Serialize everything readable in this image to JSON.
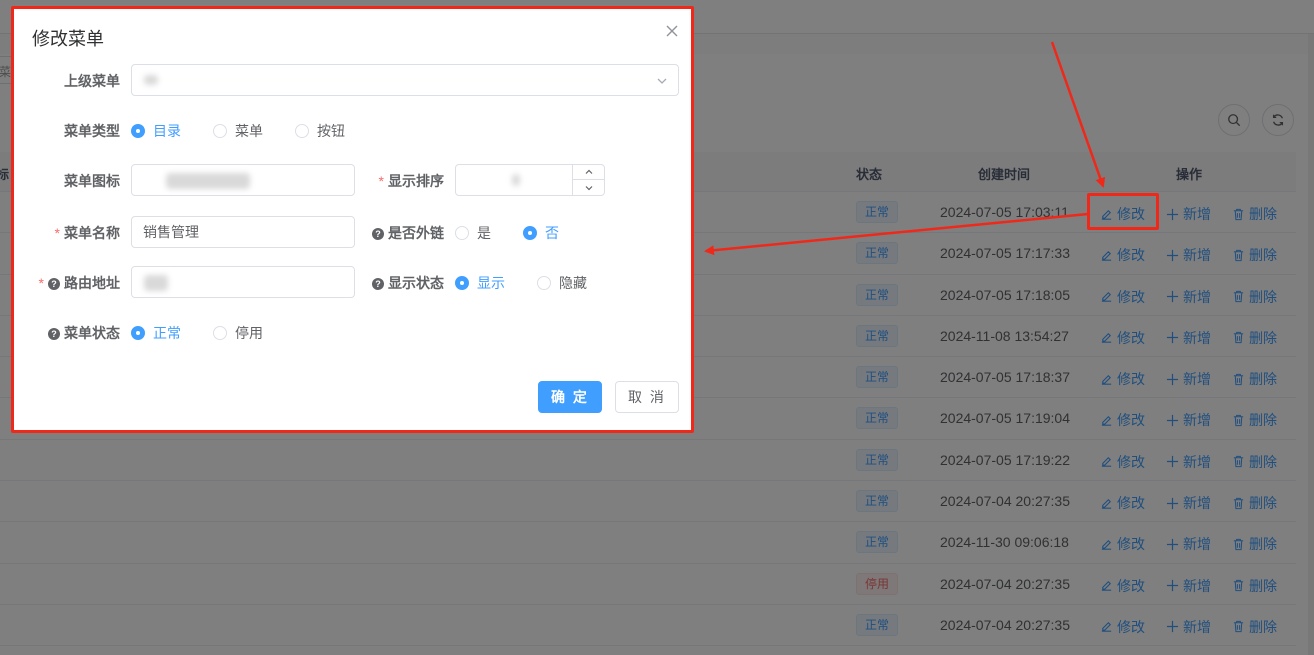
{
  "background": {
    "search_placeholder_fragment": "菜单",
    "table": {
      "headers": {
        "cut": "标",
        "status": "状态",
        "created": "创建时间",
        "ops": "操作"
      },
      "actions": {
        "edit": "修改",
        "add": "新增",
        "delete": "删除"
      },
      "rows": [
        {
          "status": "正常",
          "status_type": "normal",
          "created": "2024-07-05 17:03:11"
        },
        {
          "status": "正常",
          "status_type": "normal",
          "created": "2024-07-05 17:17:33"
        },
        {
          "status": "正常",
          "status_type": "normal",
          "created": "2024-07-05 17:18:05"
        },
        {
          "status": "正常",
          "status_type": "normal",
          "created": "2024-11-08 13:54:27"
        },
        {
          "status": "正常",
          "status_type": "normal",
          "created": "2024-07-05 17:18:37"
        },
        {
          "status": "正常",
          "status_type": "normal",
          "created": "2024-07-05 17:19:04"
        },
        {
          "status": "正常",
          "status_type": "normal",
          "created": "2024-07-05 17:19:22"
        },
        {
          "status": "正常",
          "status_type": "normal",
          "created": "2024-07-04 20:27:35"
        },
        {
          "status": "正常",
          "status_type": "normal",
          "created": "2024-11-30 09:06:18"
        },
        {
          "status": "停用",
          "status_type": "disabled",
          "created": "2024-07-04 20:27:35"
        },
        {
          "status": "正常",
          "status_type": "normal",
          "created": "2024-07-04 20:27:35"
        }
      ]
    }
  },
  "dialog": {
    "title": "修改菜单",
    "fields": {
      "parent": {
        "label": "上级菜单"
      },
      "type": {
        "label": "菜单类型",
        "options": [
          "目录",
          "菜单",
          "按钮"
        ],
        "selected": 0
      },
      "icon": {
        "label": "菜单图标"
      },
      "order": {
        "label": "显示排序"
      },
      "name": {
        "label": "菜单名称",
        "value": "销售管理"
      },
      "external": {
        "label": "是否外链",
        "options": [
          "是",
          "否"
        ],
        "selected": 1
      },
      "path": {
        "label": "路由地址"
      },
      "visible": {
        "label": "显示状态",
        "options": [
          "显示",
          "隐藏"
        ],
        "selected": 0
      },
      "status": {
        "label": "菜单状态",
        "options": [
          "正常",
          "停用"
        ],
        "selected": 0
      }
    },
    "buttons": {
      "confirm": "确 定",
      "cancel": "取 消"
    }
  },
  "colors": {
    "primary": "#409eff",
    "danger": "#f56c6c",
    "annotation": "#f0281a"
  }
}
